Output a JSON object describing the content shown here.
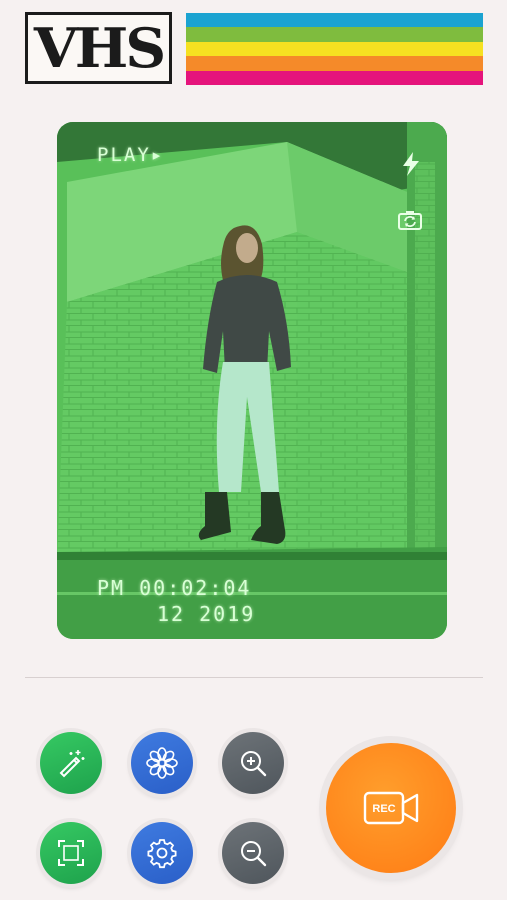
{
  "logo": {
    "text": "VHS"
  },
  "rainbow_colors": [
    "#1ba3d1",
    "#7fbc3e",
    "#f6e121",
    "#f58a29",
    "#e5147c"
  ],
  "viewfinder": {
    "mode_label": "PLAY▸",
    "time_label": "PM 00:02:04",
    "date_label": "12 2019",
    "icons": [
      "flash-icon",
      "switch-camera-icon"
    ]
  },
  "controls": {
    "buttons": [
      {
        "name": "magic-wand-button",
        "icon": "magic-wand-icon",
        "color": "green"
      },
      {
        "name": "filter-button",
        "icon": "flower-icon",
        "color": "blue"
      },
      {
        "name": "zoom-in-button",
        "icon": "zoom-in-icon",
        "color": "gray"
      },
      {
        "name": "crop-button",
        "icon": "crop-frame-icon",
        "color": "green"
      },
      {
        "name": "settings-button",
        "icon": "gear-icon",
        "color": "blue"
      },
      {
        "name": "zoom-out-button",
        "icon": "zoom-out-icon",
        "color": "gray"
      }
    ],
    "record": {
      "label": "REC",
      "icon": "video-camera-icon",
      "color": "#ff8a1c"
    }
  }
}
